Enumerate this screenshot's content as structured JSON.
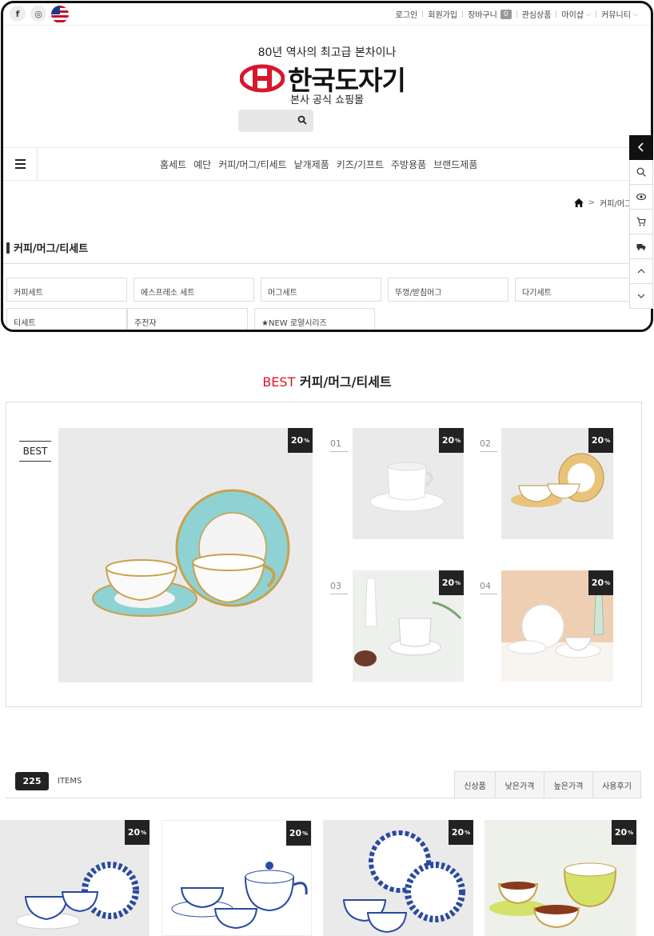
{
  "topbar": {
    "social": [
      {
        "icon": "facebook-icon",
        "glyph": "f"
      },
      {
        "icon": "instagram-icon",
        "glyph": "◎"
      }
    ],
    "links": [
      {
        "label": "로그인",
        "dropdown": false
      },
      {
        "label": "회원가입",
        "dropdown": false
      },
      {
        "label": "장바구니",
        "count": "0",
        "dropdown": false
      },
      {
        "label": "관심상품",
        "dropdown": false
      },
      {
        "label": "마이샵",
        "dropdown": true
      },
      {
        "label": "커뮤니티",
        "dropdown": true
      }
    ]
  },
  "header": {
    "tagline": "80년 역사의 최고급 본차이나",
    "logo_text": "한국도자기",
    "subtitle": "본사 공식 쇼핑몰",
    "brand_color": "#d6182c"
  },
  "nav": {
    "items": [
      "홈세트",
      "예단",
      "커피/머그/티세트",
      "낱개제품",
      "키즈/기프트",
      "주방용품",
      "브랜드제품"
    ]
  },
  "breadcrumb": {
    "current": "커피/머그/티세"
  },
  "category": {
    "title": "커피/머그/티세트",
    "subcategories": [
      "커피세트",
      "에스프레소 세트",
      "머그세트",
      "뚜껑/받침머그",
      "다기세트",
      "티세트",
      "주전자",
      "★NEW 로얄시리즈"
    ]
  },
  "best": {
    "title_accent": "BEST",
    "title_rest": "커피/머그/티세트",
    "label": "BEST",
    "main_badge": "20",
    "badge_unit": "%",
    "items": [
      {
        "rank": "01",
        "badge": "20"
      },
      {
        "rank": "02",
        "badge": "20"
      },
      {
        "rank": "03",
        "badge": "20"
      },
      {
        "rank": "04",
        "badge": "20"
      }
    ]
  },
  "listing": {
    "count": "225",
    "items_label": "ITEMS",
    "sort_tabs": [
      "신상품",
      "낮은가격",
      "높은가격",
      "사용후기"
    ],
    "products": [
      {
        "badge": "20"
      },
      {
        "badge": "20"
      },
      {
        "badge": "20"
      },
      {
        "badge": "20"
      }
    ]
  }
}
